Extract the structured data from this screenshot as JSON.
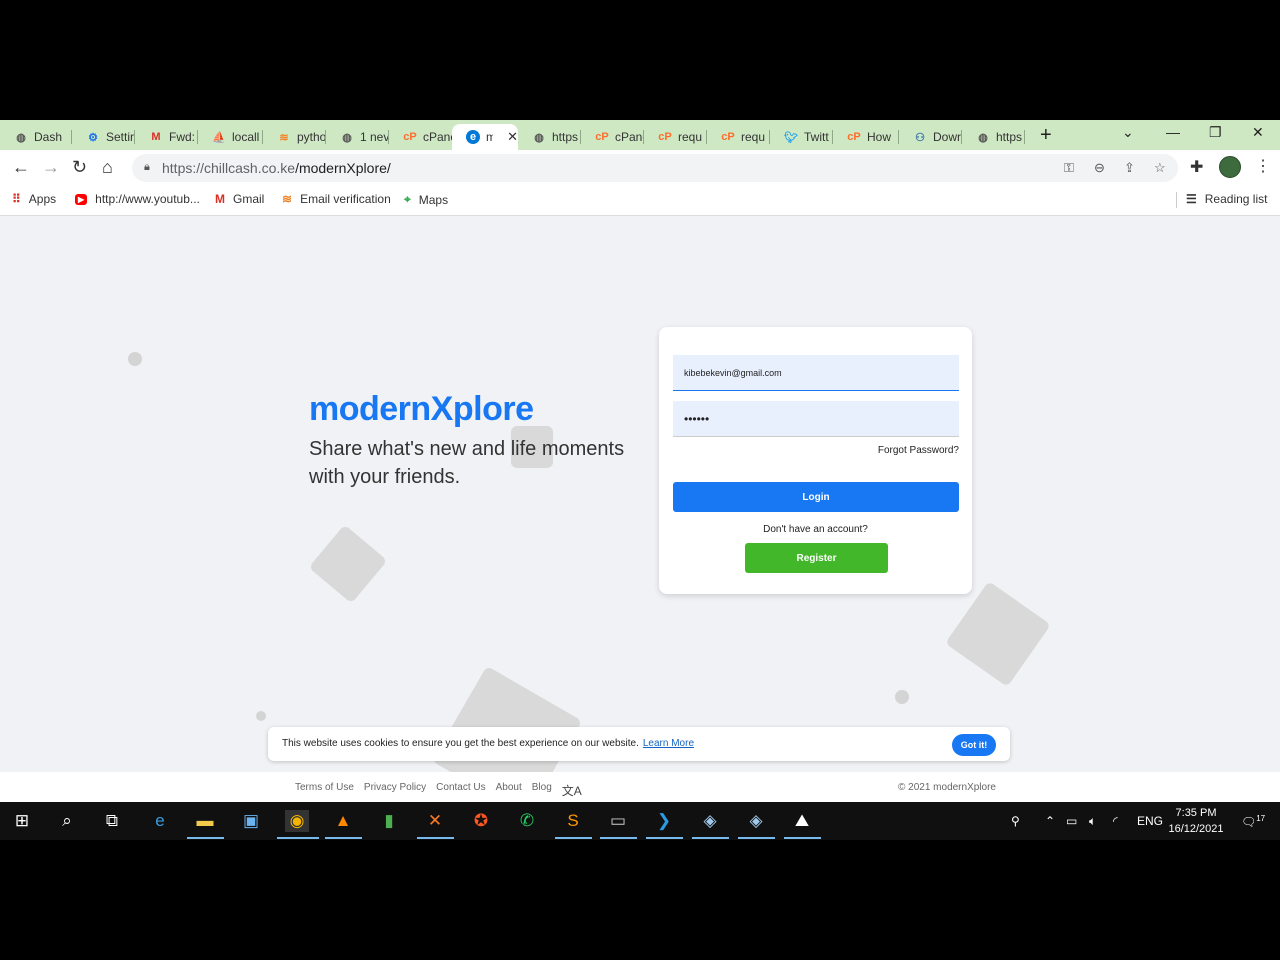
{
  "browser": {
    "tabs": [
      {
        "label": "Dash",
        "icon": "globe-icon"
      },
      {
        "label": "Settir",
        "icon": "gear-icon"
      },
      {
        "label": "Fwd:",
        "icon": "gmail-icon"
      },
      {
        "label": "locall",
        "icon": "phpmyadmin-icon"
      },
      {
        "label": "pytho",
        "icon": "stackoverflow-icon"
      },
      {
        "label": "1 nev",
        "icon": "globe-icon"
      },
      {
        "label": "cPane",
        "icon": "cpanel-icon"
      },
      {
        "label": "m",
        "icon": "edge-icon",
        "active": true
      },
      {
        "label": "https",
        "icon": "globe-icon"
      },
      {
        "label": "cPane",
        "icon": "cpanel-icon"
      },
      {
        "label": "requ",
        "icon": "cpanel-icon"
      },
      {
        "label": "requ",
        "icon": "cpanel-icon"
      },
      {
        "label": "Twitt",
        "icon": "twitter-icon"
      },
      {
        "label": "How",
        "icon": "cpanel-icon"
      },
      {
        "label": "Dowr",
        "icon": "python-icon"
      },
      {
        "label": "https",
        "icon": "globe-icon"
      }
    ],
    "url_host": "https://chillcash.co.ke",
    "url_path": "/modernXplore/",
    "bookmarks": [
      {
        "label": "Apps",
        "icon": "apps-grid-icon"
      },
      {
        "label": "http://www.youtub...",
        "icon": "youtube-icon"
      },
      {
        "label": "Gmail",
        "icon": "gmail-icon"
      },
      {
        "label": "Email verification",
        "icon": "stackoverflow-icon"
      },
      {
        "label": "Maps",
        "icon": "maps-icon"
      }
    ],
    "reading_list": "Reading list"
  },
  "site": {
    "brand": "modernXplore",
    "tagline": "Share what's new and life moments with your friends.",
    "login": {
      "email_value": "kibebekevin@gmail.com",
      "password_value": "••••••",
      "forgot": "Forgot Password?",
      "login_button": "Login",
      "no_account": "Don't have an account?",
      "register_button": "Register"
    },
    "cookie": {
      "message": "This website uses cookies to ensure you get the best experience on our website.",
      "learn_more": "Learn More",
      "accept": "Got it!"
    },
    "footer": {
      "links": [
        "Terms of Use",
        "Privacy Policy",
        "Contact Us",
        "About",
        "Blog"
      ],
      "copyright": "© 2021 modernXplore"
    },
    "colors": {
      "brand": "#1877f2",
      "register": "#42b72a",
      "background": "#f0f2f5"
    }
  },
  "taskbar": {
    "language": "ENG",
    "time": "7:35 PM",
    "date": "16/12/2021",
    "notifications": "17"
  }
}
